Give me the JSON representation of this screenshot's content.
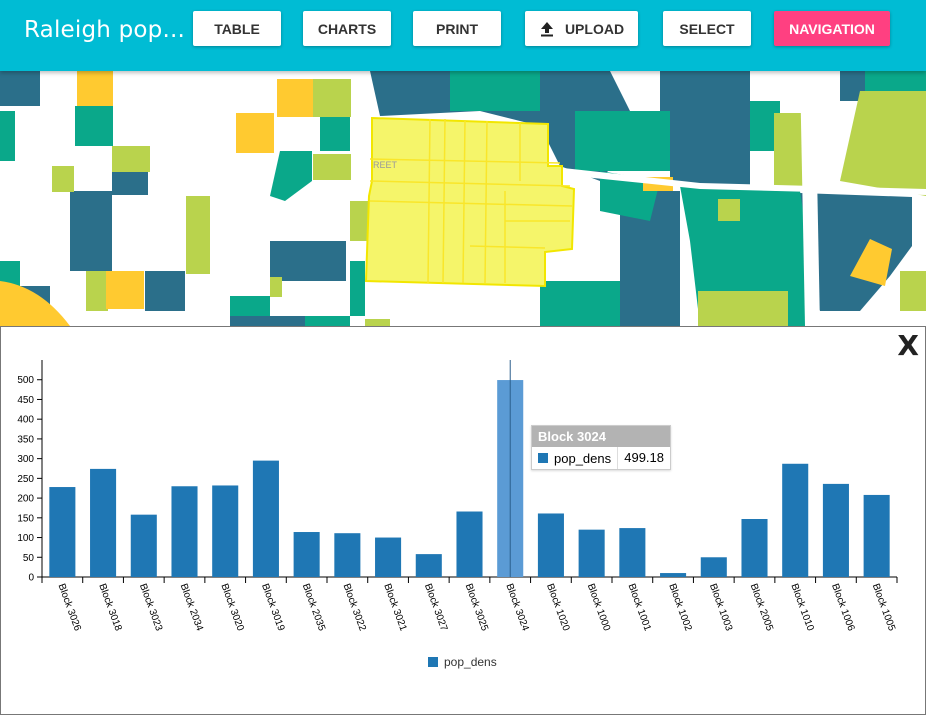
{
  "app": {
    "title": "Raleigh pop..."
  },
  "toolbar": {
    "table_label": "TABLE",
    "charts_label": "CHARTS",
    "print_label": "PRINT",
    "upload_label": "UPLOAD",
    "select_label": "SELECT",
    "navigation_label": "NAVIGATION"
  },
  "map": {
    "street_fragment": "REET"
  },
  "panel": {
    "close_label": "X"
  },
  "tooltip": {
    "title": "Block 3024",
    "series": "pop_dens",
    "value": "499.18"
  },
  "colors": {
    "topbar": "#00bcd4",
    "navigation_button": "#ff4081",
    "bar": "#1f77b4",
    "bar_highlight": "#5b9bd5",
    "map_dark": "#2b6f8a",
    "map_teal": "#0aa88a",
    "map_lime": "#b9d34d",
    "map_yellow": "#ffca30",
    "map_selection": "#f5f56a"
  },
  "chart_data": {
    "type": "bar",
    "categories": [
      "Block 3026",
      "Block 3018",
      "Block 3023",
      "Block 2034",
      "Block 3020",
      "Block 3019",
      "Block 2035",
      "Block 3022",
      "Block 3021",
      "Block 3027",
      "Block 3025",
      "Block 3024",
      "Block 1020",
      "Block 1000",
      "Block 1001",
      "Block 1002",
      "Block 1003",
      "Block 2005",
      "Block 1010",
      "Block 1006",
      "Block 1005"
    ],
    "series": [
      {
        "name": "pop_dens",
        "values": [
          228,
          274,
          158,
          230,
          232,
          295,
          114,
          111,
          100,
          58,
          166,
          499.18,
          161,
          120,
          124,
          10,
          50,
          147,
          287,
          236,
          208
        ]
      }
    ],
    "highlighted_category": "Block 3024",
    "yticks": [
      0,
      50,
      100,
      150,
      200,
      250,
      300,
      350,
      400,
      450,
      500
    ],
    "ylim": [
      0,
      550
    ],
    "legend": [
      "pop_dens"
    ],
    "legend_position": "bottom-center",
    "grid": false
  }
}
